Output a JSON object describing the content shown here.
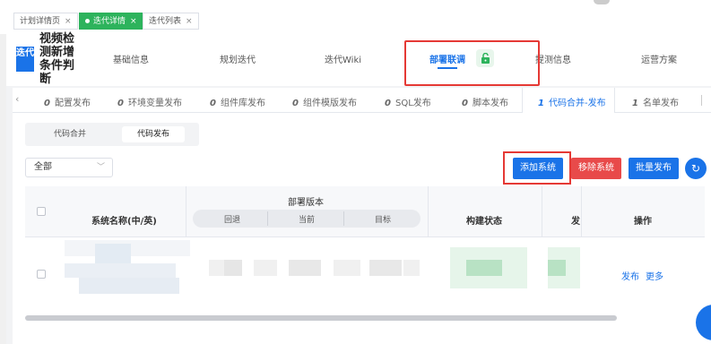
{
  "page_tabs": [
    {
      "label": "计划详情页",
      "active": false
    },
    {
      "label": "迭代详情",
      "active": true
    },
    {
      "label": "迭代列表",
      "active": false
    }
  ],
  "header": {
    "logo_text": "迭代",
    "title": "视频检测新增条件判断",
    "tabs": [
      "基础信息",
      "规划迭代",
      "迭代Wiki",
      "部署联调",
      "提测信息",
      "运营方案"
    ],
    "active_tab": "部署联调",
    "lock_icon": "unlock-icon"
  },
  "sub_tabs": [
    {
      "count": "0",
      "label": "配置发布"
    },
    {
      "count": "0",
      "label": "环境变量发布"
    },
    {
      "count": "0",
      "label": "组件库发布"
    },
    {
      "count": "0",
      "label": "组件模版发布"
    },
    {
      "count": "0",
      "label": "SQL发布"
    },
    {
      "count": "0",
      "label": "脚本发布"
    },
    {
      "count": "1",
      "label": "代码合并-发布"
    },
    {
      "count": "1",
      "label": "名单发布"
    }
  ],
  "segment": {
    "items": [
      "代码合并",
      "代码发布"
    ],
    "active": "代码发布"
  },
  "filter": {
    "value": "全部"
  },
  "actions": {
    "add": "添加系统",
    "remove": "移除系统",
    "batch": "批量发布",
    "refresh_icon": "refresh-icon"
  },
  "colors": {
    "primary": "#1a73e8",
    "danger": "#e84a4a",
    "success": "#2db35c",
    "highlight": "#e53935"
  },
  "table": {
    "headers": {
      "name": "系统名称(中/英)",
      "version": "部署版本",
      "build": "构建状态",
      "deploy": "发",
      "ops": "操作"
    },
    "version_sub": [
      "回退",
      "当前",
      "目标"
    ],
    "row_actions": [
      "发布",
      "更多"
    ]
  }
}
